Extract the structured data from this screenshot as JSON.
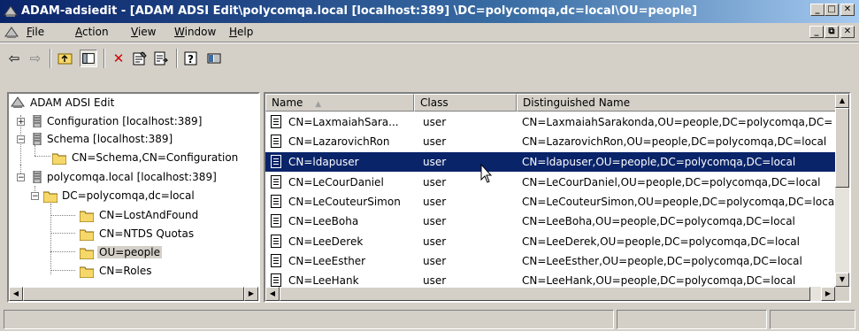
{
  "window": {
    "title": "ADAM-adsiedit - [ADAM ADSI Edit\\polycomqa.local [localhost:389] \\DC=polycomqa,dc=local\\OU=people]"
  },
  "menu": [
    "File",
    "Action",
    "View",
    "Window",
    "Help"
  ],
  "menu_mnemonics": [
    "F",
    "A",
    "V",
    "W",
    "H"
  ],
  "toolbar": [
    "back-icon",
    "forward-icon",
    "up-one-level-icon",
    "show-hide-console-tree-icon",
    "delete-icon",
    "properties-icon",
    "export-list-icon",
    "help-icon",
    "mmc-console-icon"
  ],
  "tree": [
    {
      "label": "ADAM ADSI Edit",
      "icon": "adsi-edit-icon"
    },
    {
      "label": "Configuration [localhost:389]",
      "icon": "server-icon",
      "expander": "+"
    },
    {
      "label": "Schema [localhost:389]",
      "icon": "server-icon",
      "expander": "−"
    },
    {
      "label": "CN=Schema,CN=Configuration",
      "icon": "folder-icon"
    },
    {
      "label": "polycomqa.local [localhost:389]",
      "icon": "server-icon",
      "expander": "−"
    },
    {
      "label": "DC=polycomqa,dc=local",
      "icon": "folder-icon",
      "expander": "−"
    },
    {
      "label": "CN=LostAndFound",
      "icon": "folder-icon"
    },
    {
      "label": "CN=NTDS Quotas",
      "icon": "folder-icon"
    },
    {
      "label": "OU=people",
      "icon": "folder-icon",
      "selected": true
    },
    {
      "label": "CN=Roles",
      "icon": "folder-icon"
    }
  ],
  "list": {
    "columns": [
      "Name",
      "Class",
      "Distinguished Name"
    ],
    "sort_indicator": "▲",
    "rows": [
      {
        "name": "CN=LaxmaiahSara...",
        "class": "user",
        "dn": "CN=LaxmaiahSarakonda,OU=people,DC=polycomqa,DC="
      },
      {
        "name": "CN=LazarovichRon",
        "class": "user",
        "dn": "CN=LazarovichRon,OU=people,DC=polycomqa,DC=local"
      },
      {
        "name": "CN=ldapuser",
        "class": "user",
        "dn": "CN=ldapuser,OU=people,DC=polycomqa,DC=local",
        "selected": true
      },
      {
        "name": "CN=LeCourDaniel",
        "class": "user",
        "dn": "CN=LeCourDaniel,OU=people,DC=polycomqa,DC=local"
      },
      {
        "name": "CN=LeCouteurSimon",
        "class": "user",
        "dn": "CN=LeCouteurSimon,OU=people,DC=polycomqa,DC=loca"
      },
      {
        "name": "CN=LeeBoha",
        "class": "user",
        "dn": "CN=LeeBoha,OU=people,DC=polycomqa,DC=local"
      },
      {
        "name": "CN=LeeDerek",
        "class": "user",
        "dn": "CN=LeeDerek,OU=people,DC=polycomqa,DC=local"
      },
      {
        "name": "CN=LeeEsther",
        "class": "user",
        "dn": "CN=LeeEsther,OU=people,DC=polycomqa,DC=local"
      },
      {
        "name": "CN=LeeHank",
        "class": "user",
        "dn": "CN=LeeHank,OU=people,DC=polycomqa,DC=local"
      }
    ]
  },
  "colors": {
    "titlebar_start": "#0a246a",
    "titlebar_end": "#a6caf0",
    "selection": "#0a246a",
    "face": "#d4d0c8",
    "folder": "#f6d86a"
  },
  "window_controls": [
    "_",
    "□",
    "✕"
  ],
  "mdi_controls": [
    "_",
    "⧉",
    "✕"
  ]
}
